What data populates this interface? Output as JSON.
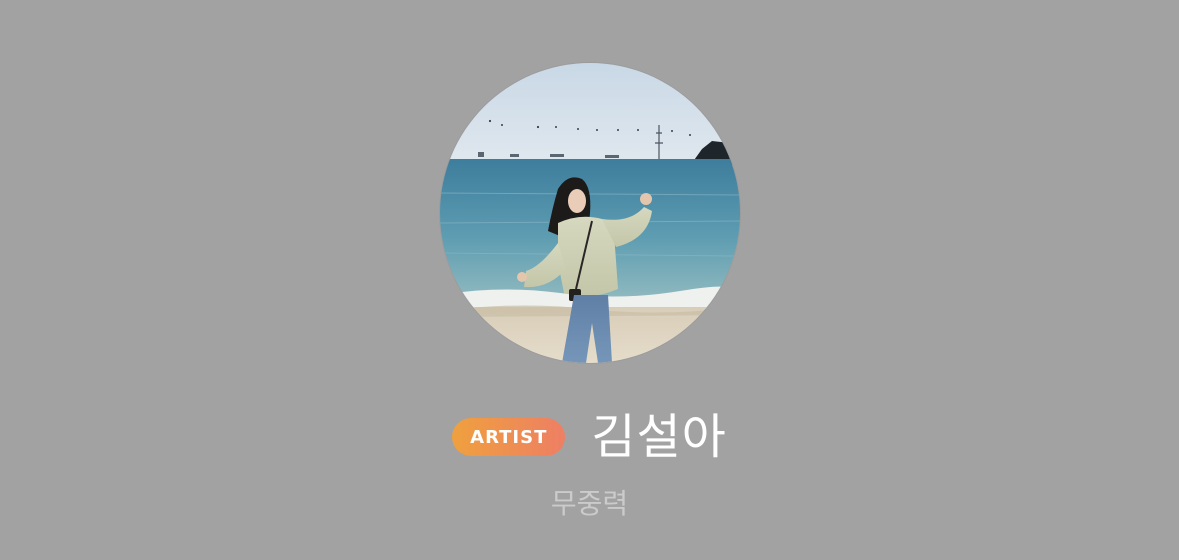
{
  "profile": {
    "badge": "ARTIST",
    "name": "김설아",
    "group": "무중력",
    "avatar_icon": "profile-photo"
  },
  "colors": {
    "background": "#a2a2a2",
    "badge_gradient_start": "#efa03e",
    "badge_gradient_end": "#ee7f64",
    "name_text": "#ffffff",
    "group_text": "#cbcbcb"
  }
}
